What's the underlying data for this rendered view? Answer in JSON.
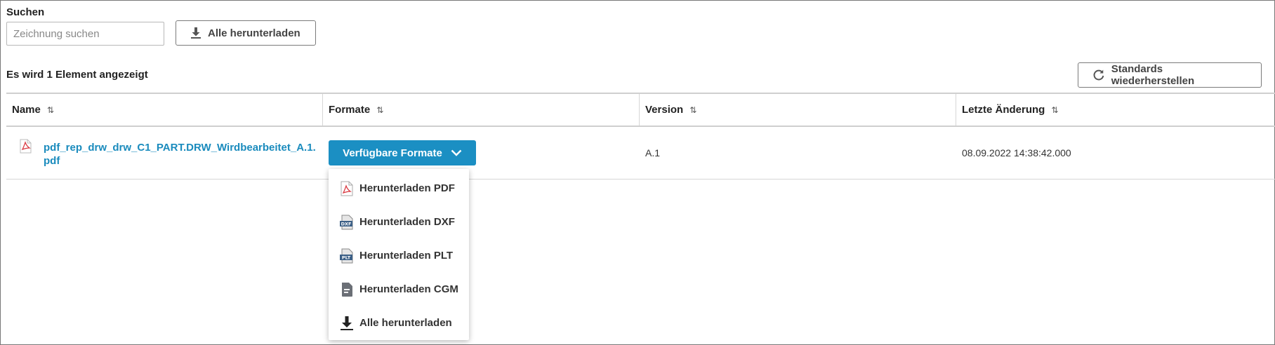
{
  "search": {
    "label": "Suchen",
    "placeholder": "Zeichnung suchen",
    "value": ""
  },
  "toolbar": {
    "download_all_label": "Alle herunterladen",
    "restore_defaults_label": "Standards wiederherstellen"
  },
  "results": {
    "count_text": "Es wird 1 Element angezeigt"
  },
  "table": {
    "columns": [
      "Name",
      "Formate",
      "Version",
      "Letzte Änderung"
    ],
    "rows": [
      {
        "name": "pdf_rep_drw_drw_C1_PART.DRW_Wirdbearbeitet_A.1.pdf",
        "formats_button": "Verfügbare Formate",
        "version": "A.1",
        "modified": "08.09.2022 14:38:42.000"
      }
    ]
  },
  "formats_menu": {
    "items": [
      {
        "label": "Herunterladen PDF",
        "icon": "pdf-file-icon"
      },
      {
        "label": "Herunterladen DXF",
        "icon": "dxf-file-icon"
      },
      {
        "label": "Herunterladen PLT",
        "icon": "plt-file-icon"
      },
      {
        "label": "Herunterladen CGM",
        "icon": "document-icon"
      },
      {
        "label": "Alle herunterladen",
        "icon": "download-icon"
      }
    ]
  },
  "colors": {
    "accent": "#1b8fc3",
    "link": "#1a8bbd",
    "pdf_red": "#d9363e"
  }
}
